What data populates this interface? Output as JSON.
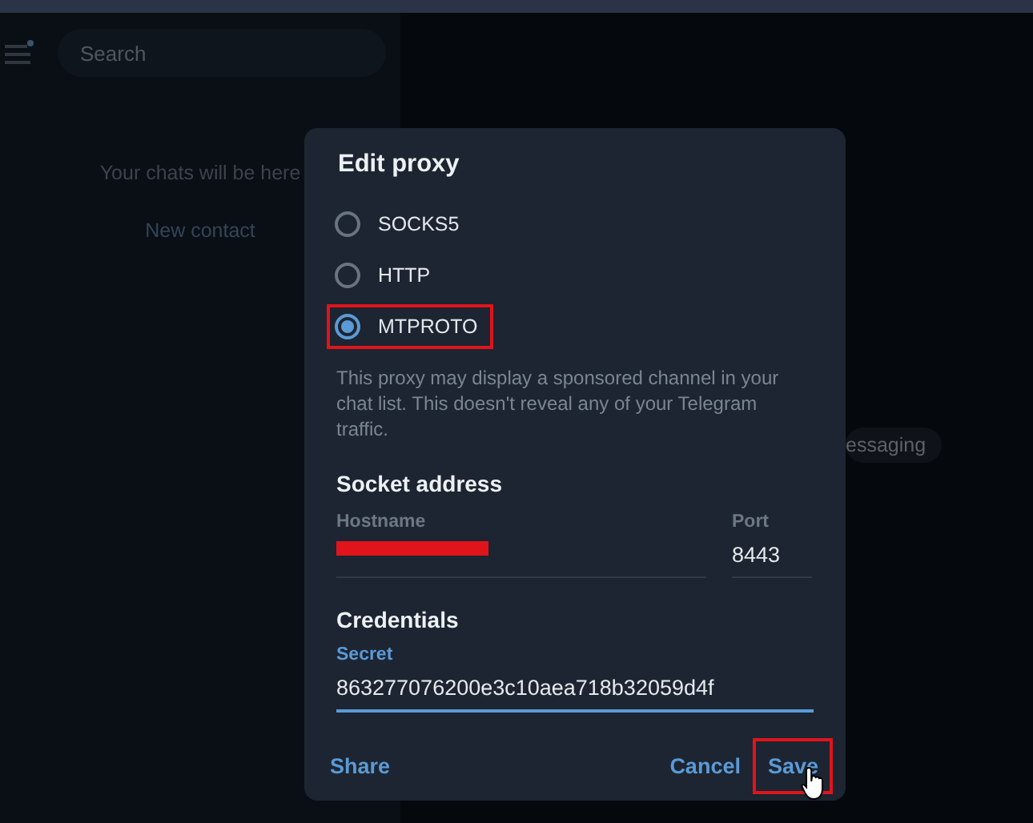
{
  "sidebar": {
    "search": {
      "placeholder": "Search"
    },
    "empty_text": "Your chats will be here",
    "new_contact": "New contact"
  },
  "background_pill": "essaging",
  "dialog": {
    "title": "Edit proxy",
    "options": [
      {
        "label": "SOCKS5",
        "selected": false,
        "highlighted": false
      },
      {
        "label": "HTTP",
        "selected": false,
        "highlighted": false
      },
      {
        "label": "MTPROTO",
        "selected": true,
        "highlighted": true
      }
    ],
    "note": "This proxy may display a sponsored channel in your chat list. This doesn't reveal any of your Telegram traffic.",
    "socket_title": "Socket address",
    "hostname": {
      "label": "Hostname",
      "redacted": true
    },
    "port": {
      "label": "Port",
      "value": "8443"
    },
    "credentials_title": "Credentials",
    "secret": {
      "label": "Secret",
      "value": "863277076200e3c10aea718b32059d4f"
    },
    "left_buttons": [
      {
        "label": "Share",
        "highlighted": false
      }
    ],
    "right_buttons": [
      {
        "label": "Cancel",
        "highlighted": false
      },
      {
        "label": "Save",
        "highlighted": true
      }
    ]
  }
}
